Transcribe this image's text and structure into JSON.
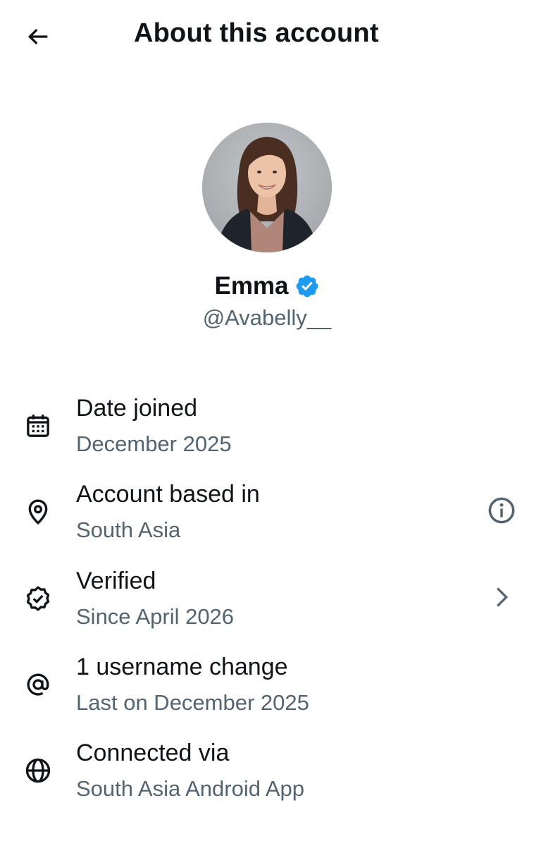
{
  "header": {
    "title": "About this account",
    "back_icon": "arrow-left-icon"
  },
  "profile": {
    "display_name": "Emma",
    "handle": "@Avabelly__",
    "verified_badge_icon": "verified-badge-icon",
    "verified_badge_color": "#1d9bf0",
    "avatar_alt": "profile photo"
  },
  "details": [
    {
      "icon": "calendar-icon",
      "label": "Date joined",
      "value": "December 2025",
      "action_icon": ""
    },
    {
      "icon": "location-pin-icon",
      "label": "Account based in",
      "value": "South Asia",
      "action_icon": "info-icon"
    },
    {
      "icon": "verified-seal-icon",
      "label": "Verified",
      "value": "Since April 2026",
      "action_icon": "chevron-right-icon"
    },
    {
      "icon": "at-sign-icon",
      "label": "1 username change",
      "value": "Last on December 2025",
      "action_icon": ""
    },
    {
      "icon": "globe-icon",
      "label": "Connected via",
      "value": "South Asia Android App",
      "action_icon": ""
    }
  ],
  "colors": {
    "primary_text": "#0f1419",
    "secondary_text": "#536471",
    "accent": "#1d9bf0",
    "background": "#ffffff"
  }
}
